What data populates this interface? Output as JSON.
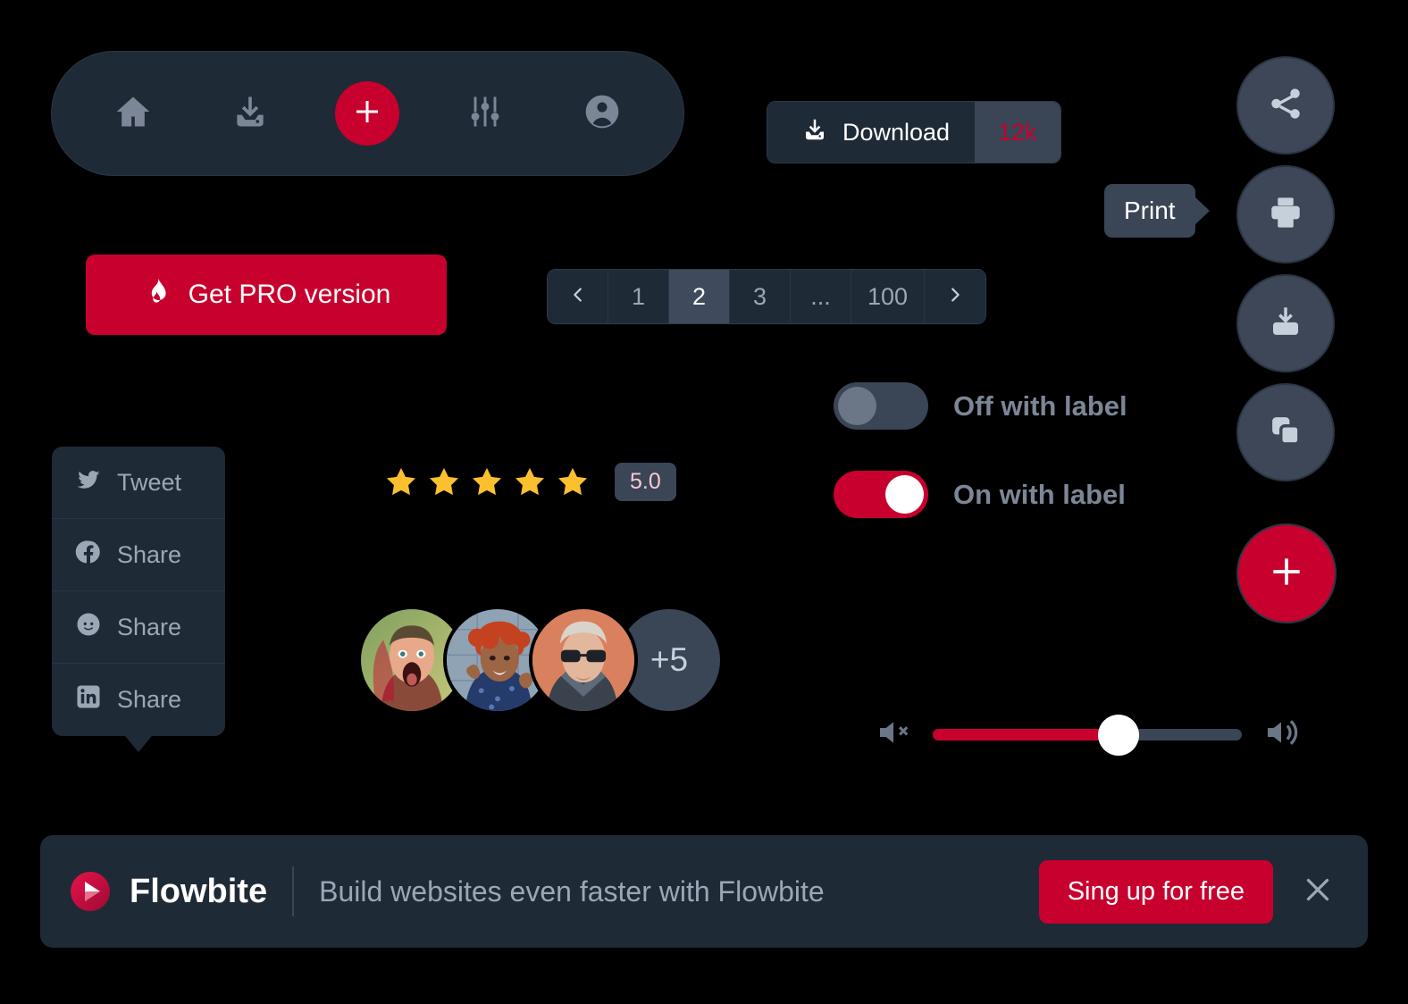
{
  "colors": {
    "background": "#000000",
    "surface": "#1F2A37",
    "surface_light": "#3A4556",
    "accent_red": "#C8002E",
    "text_muted": "#9CA7B5",
    "star_yellow": "#FBC02D"
  },
  "bottom_nav": {
    "items": [
      {
        "name": "home-icon",
        "label": "Home"
      },
      {
        "name": "download-icon",
        "label": "Download"
      },
      {
        "name": "plus-icon",
        "label": "Add new"
      },
      {
        "name": "settings-sliders-icon",
        "label": "Settings"
      },
      {
        "name": "user-profile-icon",
        "label": "Profile"
      }
    ]
  },
  "download_button": {
    "label": "Download",
    "count": "12k",
    "icon": "download-icon"
  },
  "pro_button": {
    "label": "Get PRO version",
    "icon": "fire-icon"
  },
  "pagination": {
    "prev_icon": "chevron-left-icon",
    "next_icon": "chevron-right-icon",
    "pages": [
      {
        "label": "1",
        "active": false
      },
      {
        "label": "2",
        "active": true
      },
      {
        "label": "3",
        "active": false
      },
      {
        "label": "...",
        "active": false
      },
      {
        "label": "100",
        "active": false
      }
    ]
  },
  "social_menu": {
    "items": [
      {
        "icon": "twitter-icon",
        "label": "Tweet"
      },
      {
        "icon": "facebook-icon",
        "label": "Share"
      },
      {
        "icon": "reddit-icon",
        "label": "Share"
      },
      {
        "icon": "linkedin-icon",
        "label": "Share"
      }
    ]
  },
  "rating": {
    "stars_filled": 5,
    "stars_total": 5,
    "score": "5.0"
  },
  "toggles": [
    {
      "label": "Off with label",
      "state": "off"
    },
    {
      "label": "On with label",
      "state": "on"
    }
  ],
  "avatar_group": {
    "avatars": [
      {
        "name": "avatar-photo-1"
      },
      {
        "name": "avatar-photo-2"
      },
      {
        "name": "avatar-photo-3"
      }
    ],
    "more_label": "+5"
  },
  "volume_slider": {
    "mute_icon": "volume-mute-icon",
    "up_icon": "volume-up-icon",
    "value_percent": 60
  },
  "speed_dial": {
    "tooltip_label": "Print",
    "buttons": [
      {
        "icon": "share-icon",
        "label": "Share"
      },
      {
        "icon": "print-icon",
        "label": "Print"
      },
      {
        "icon": "download-box-icon",
        "label": "Download"
      },
      {
        "icon": "copy-icon",
        "label": "Copy"
      }
    ],
    "main_icon": "plus-icon"
  },
  "banner": {
    "brand_name": "Flowbite",
    "brand_logo": "flowbite-logo-icon",
    "message": "Build websites even faster with Flowbite",
    "cta_label": "Sing up for free",
    "close_icon": "close-icon"
  }
}
